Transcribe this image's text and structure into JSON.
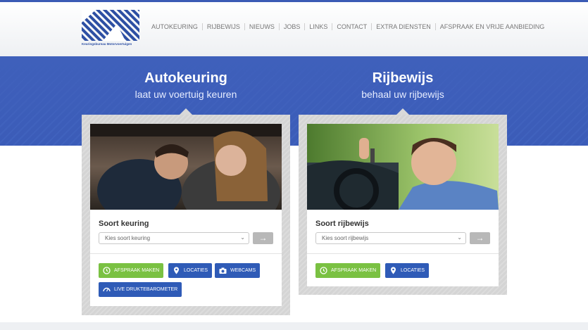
{
  "header": {
    "logo_caption": "Keuringsbureau Motorvoertuigen",
    "nav": [
      "AUTOKEURING",
      "RIJBEWIJS",
      "NIEUWS",
      "JOBS",
      "LINKS",
      "CONTACT",
      "EXTRA DIENSTEN",
      "AFSPRAAK EN VRIJE AANBIEDING"
    ]
  },
  "hero": {
    "left_title": "Autokeuring",
    "left_subtitle": "laat uw voertuig keuren",
    "right_title": "Rijbewijs",
    "right_subtitle": "behaal uw rijbewijs"
  },
  "autokeuring": {
    "label": "Soort keuring",
    "select_value": "Kies soort keuring",
    "buttons": [
      "AFSPRAAK MAKEN",
      "LOCATIES",
      "WEBCAMS",
      "LIVE DRUKTEBAROMETER"
    ]
  },
  "rijbewijs": {
    "label": "Soort rijbewijs",
    "select_value": "Kies soort rijbewijs",
    "buttons": [
      "AFSPRAAK MAKEN",
      "LOCATIES"
    ]
  },
  "icons": {
    "go": "arrow-right-icon",
    "clock": "clock-icon",
    "pin": "map-pin-icon",
    "camera": "camera-icon",
    "gauge": "gauge-icon"
  },
  "colors": {
    "brand_blue": "#3b5cb8",
    "button_blue": "#2f5bb7",
    "button_green": "#7ac142"
  }
}
